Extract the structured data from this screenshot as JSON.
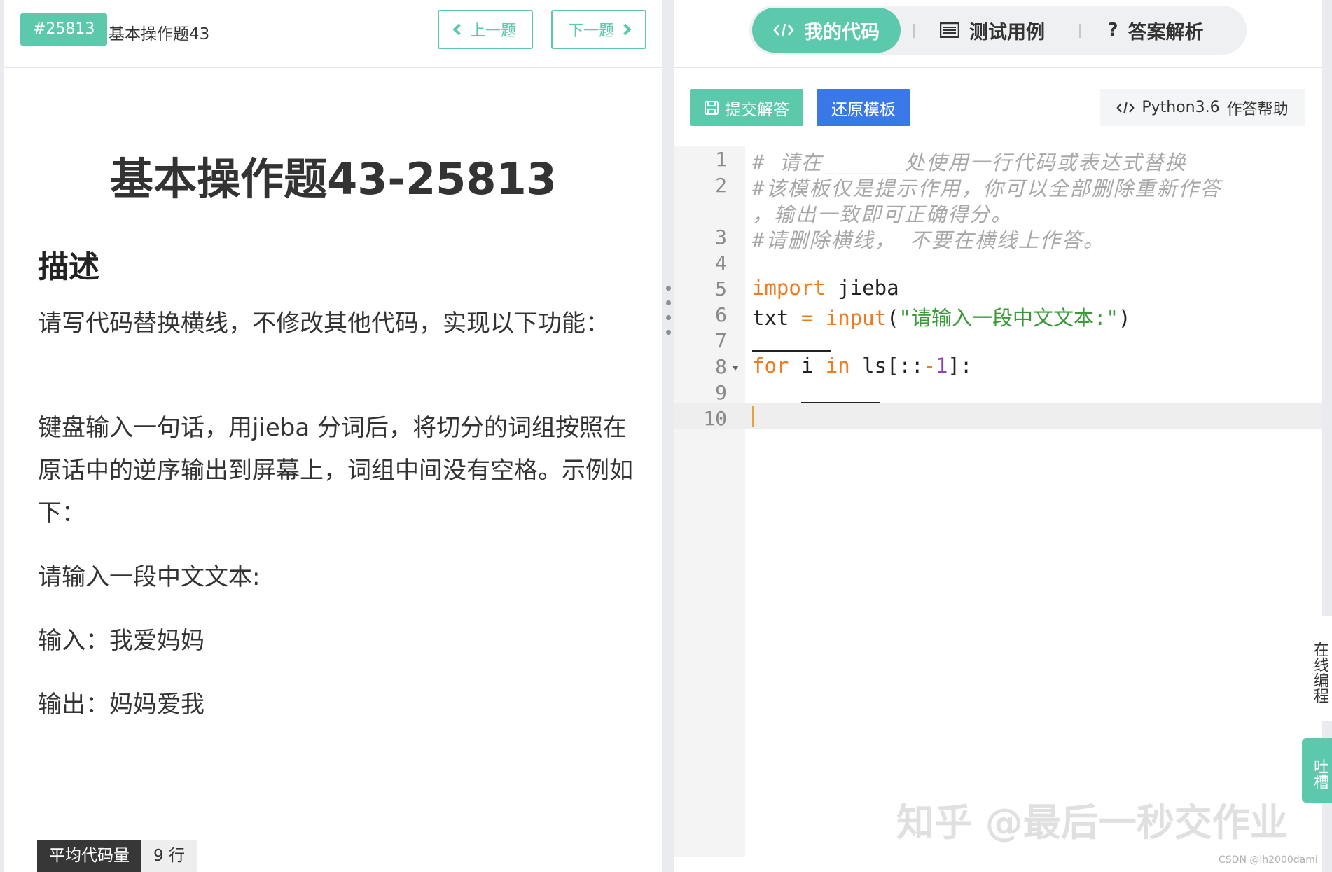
{
  "problem": {
    "id_badge": "#25813",
    "short_name": "基本操作题43",
    "prev_label": "上一题",
    "next_label": "下一题",
    "title": "基本操作题43-25813",
    "section_title": "描述",
    "paragraphs": [
      " 请写代码替换横线，不修改其他代码，实现以下功能：",
      "键盘输入一句话，用jieba 分词后，将切分的词组按照在原话中的逆序输出到屏幕上，词组中间没有空格。示例如下：",
      "请输入一段中文文本:",
      "输入：我爱妈妈",
      "输出：妈妈爱我"
    ],
    "avg_label": "平均代码量",
    "avg_value": "9 行"
  },
  "tabs": [
    {
      "label": "我的代码",
      "icon": "code-icon",
      "active": true
    },
    {
      "label": "测试用例",
      "icon": "list-icon",
      "active": false
    },
    {
      "label": "答案解析",
      "icon": "question-icon",
      "active": false
    }
  ],
  "toolbar": {
    "submit_label": "提交解答",
    "reset_label": "还原模板",
    "language": "Python3.6",
    "help_label": "作答帮助"
  },
  "editor": {
    "line_numbers": [
      "1",
      "2",
      "3",
      "4",
      "5",
      "6",
      "7",
      "8",
      "9",
      "10"
    ],
    "comment_1": "# 请在______处使用一行代码或表达式替换",
    "comment_2a": "#该模板仅是提示作用，你可以全部删除重新作答",
    "comment_2b": "，输出一致即可正确得分。",
    "comment_3": "#请删除横线， 不要在横线上作答。",
    "import_kw": "import",
    "import_mod": " jieba",
    "txt_var": "txt ",
    "eq": "=",
    "input_fn": " input",
    "input_open": "(",
    "input_str": "\"请输入一段中文文本:\"",
    "input_close": ")",
    "for_kw": "for",
    "for_var": " i ",
    "in_kw": "in",
    "ls_open": " ls[::",
    "minus": "-",
    "one": "1",
    "ls_close": "]:",
    "indent": "    "
  },
  "side": {
    "online_label": "在线编程",
    "tucao_label": "吐槽"
  },
  "watermark": "知乎 @最后一秒交作业",
  "csdn_mark": "CSDN @lh2000dami",
  "colors": {
    "accent": "#5cc8ac",
    "blue": "#3b78e7",
    "keyword": "#f07a1e",
    "string": "#3a9a3a",
    "number": "#8e44ad"
  }
}
